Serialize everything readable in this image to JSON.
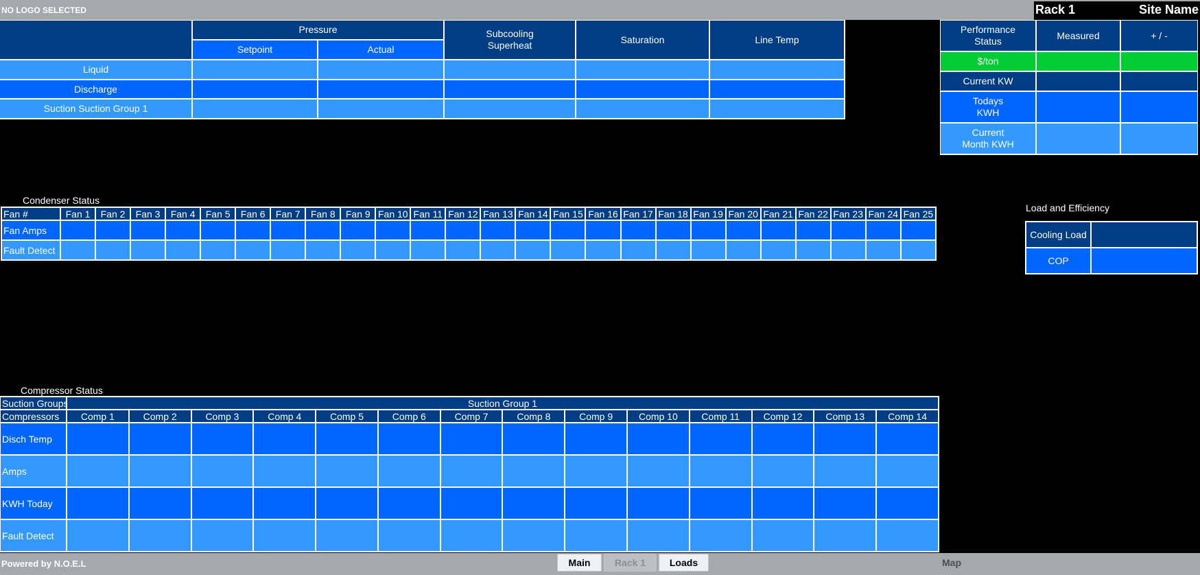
{
  "header": {
    "logo_text": "NO LOGO SELECTED",
    "rack_title": "Rack 1",
    "site_name": "Site Name"
  },
  "pressure_table": {
    "group_header": "Pressure",
    "setpoint": "Setpoint",
    "actual": "Actual",
    "subcooling": "Subcooling\nSuperheat",
    "saturation": "Saturation",
    "line_temp": "Line Temp",
    "rows": [
      "Liquid",
      "Discharge",
      "Suction Suction Group 1"
    ]
  },
  "performance": {
    "header": "Performance\nStatus",
    "measured": "Measured",
    "plus_minus": "+ / -",
    "rows": [
      "$/ton",
      "Current KW",
      "Todays\nKWH",
      "Current\nMonth KWH"
    ]
  },
  "condenser": {
    "title": "Condenser Status",
    "fan_label": "Fan #",
    "fans": [
      "Fan 1",
      "Fan 2",
      "Fan 3",
      "Fan 4",
      "Fan 5",
      "Fan 6",
      "Fan 7",
      "Fan 8",
      "Fan 9",
      "Fan 10",
      "Fan 11",
      "Fan 12",
      "Fan 13",
      "Fan 14",
      "Fan 15",
      "Fan 16",
      "Fan 17",
      "Fan 18",
      "Fan 19",
      "Fan 20",
      "Fan 21",
      "Fan 22",
      "Fan 23",
      "Fan 24",
      "Fan 25"
    ],
    "rows": [
      "Fan Amps",
      "Fault Detect"
    ]
  },
  "load_efficiency": {
    "title": "Load and Efficiency",
    "rows": [
      "Cooling Load",
      "COP"
    ]
  },
  "compressor": {
    "title": "Compressor Status",
    "suction_groups_label": "Suction Groups",
    "suction_group": "Suction Group 1",
    "compressors_label": "Compressors",
    "comps": [
      "Comp 1",
      "Comp 2",
      "Comp 3",
      "Comp 4",
      "Comp 5",
      "Comp 6",
      "Comp 7",
      "Comp 8",
      "Comp 9",
      "Comp 10",
      "Comp 11",
      "Comp 12",
      "Comp 13",
      "Comp 14"
    ],
    "rows": [
      "Disch Temp",
      "Amps",
      "KWH Today",
      "Fault Detect"
    ]
  },
  "footer": {
    "powered_by": "Powered by N.O.E.L",
    "nav": [
      "Main",
      "Rack 1",
      "Loads"
    ],
    "map": "Map"
  },
  "colors": {
    "dark_header": "#003d85",
    "blue": "#0066ff",
    "light_blue": "#3399ff",
    "green": "#00cc33",
    "bar_gray": "#a5a8ad"
  }
}
